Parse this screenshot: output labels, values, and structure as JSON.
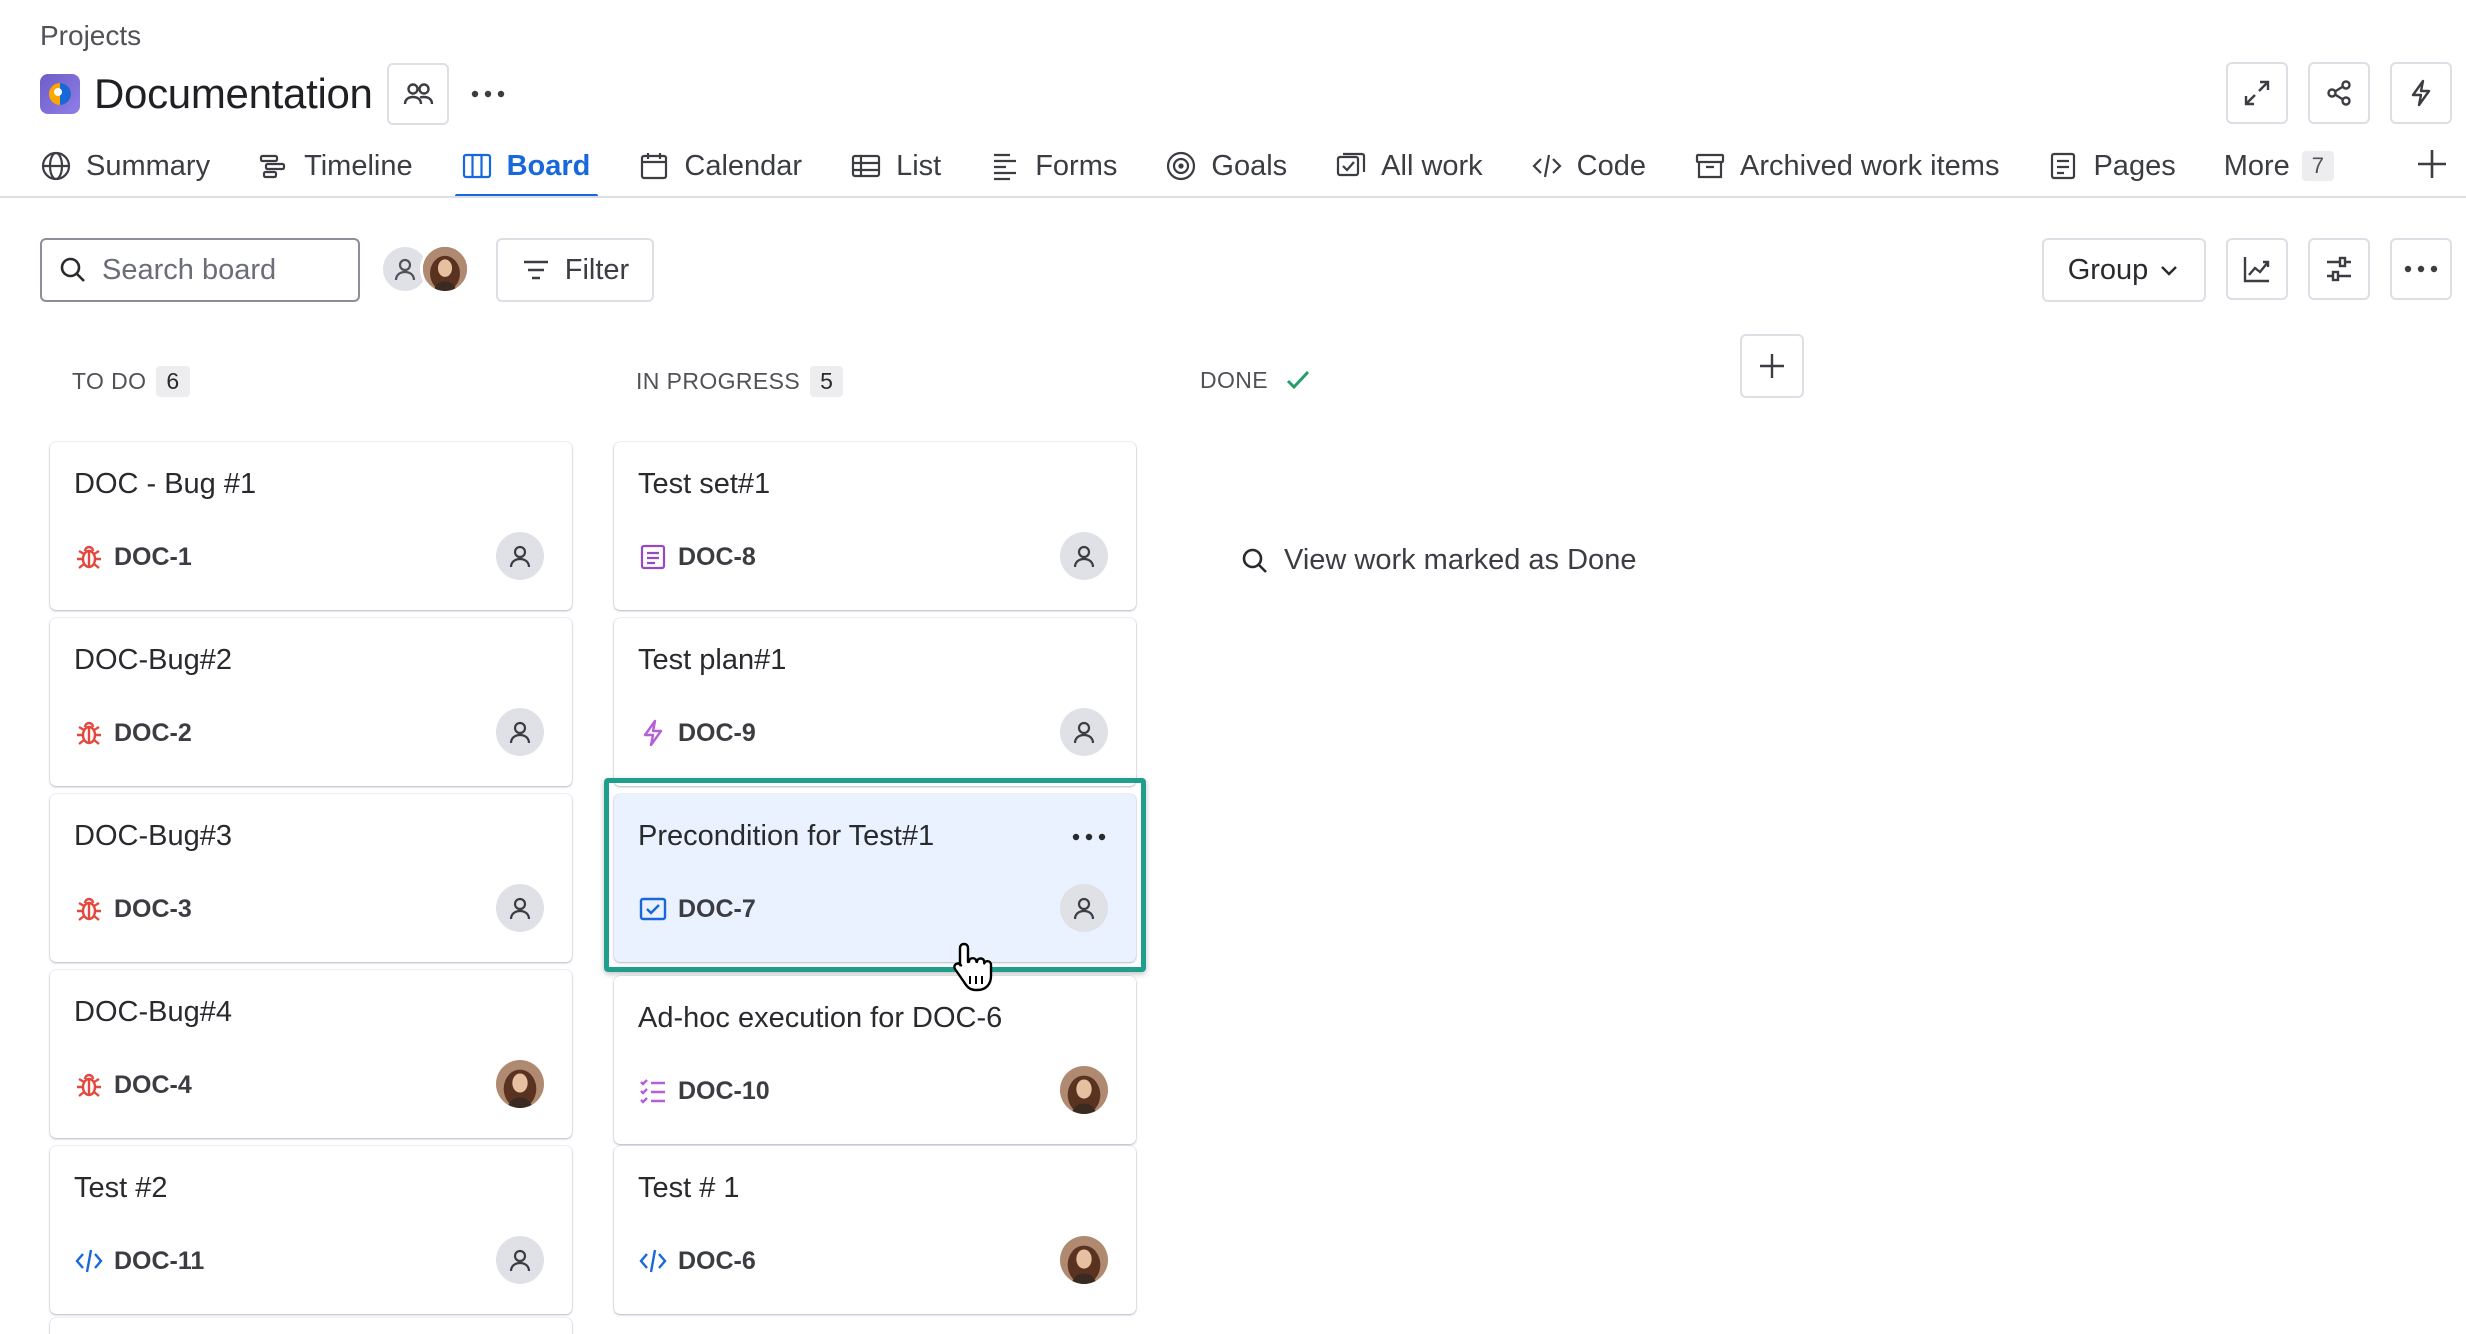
{
  "breadcrumb": "Projects",
  "project": {
    "title": "Documentation"
  },
  "tabs": [
    {
      "label": "Summary",
      "icon": "globe-icon"
    },
    {
      "label": "Timeline",
      "icon": "timeline-icon"
    },
    {
      "label": "Board",
      "icon": "board-icon",
      "active": true
    },
    {
      "label": "Calendar",
      "icon": "calendar-icon"
    },
    {
      "label": "List",
      "icon": "list-icon"
    },
    {
      "label": "Forms",
      "icon": "forms-icon"
    },
    {
      "label": "Goals",
      "icon": "goals-icon"
    },
    {
      "label": "All work",
      "icon": "all-work-icon"
    },
    {
      "label": "Code",
      "icon": "code-icon"
    },
    {
      "label": "Archived work items",
      "icon": "archive-icon"
    },
    {
      "label": "Pages",
      "icon": "pages-icon"
    }
  ],
  "more": {
    "label": "More",
    "count": "7"
  },
  "toolbar": {
    "search_placeholder": "Search board",
    "filter_label": "Filter",
    "group_label": "Group"
  },
  "columns": [
    {
      "name": "TO DO",
      "count": "6"
    },
    {
      "name": "IN PROGRESS",
      "count": "5"
    },
    {
      "name": "DONE"
    }
  ],
  "todo_cards": [
    {
      "title": "DOC - Bug #1",
      "key": "DOC-1",
      "type": "bug-icon",
      "assignee": "unassigned"
    },
    {
      "title": "DOC-Bug#2",
      "key": "DOC-2",
      "type": "bug-icon",
      "assignee": "unassigned"
    },
    {
      "title": "DOC-Bug#3",
      "key": "DOC-3",
      "type": "bug-icon",
      "assignee": "unassigned"
    },
    {
      "title": "DOC-Bug#4",
      "key": "DOC-4",
      "type": "bug-icon",
      "assignee": "user-photo"
    },
    {
      "title": "Test #2",
      "key": "DOC-11",
      "type": "code-test-icon",
      "assignee": "unassigned"
    }
  ],
  "progress_cards": [
    {
      "title": "Test set#1",
      "key": "DOC-8",
      "type": "test-set-icon",
      "assignee": "unassigned"
    },
    {
      "title": "Test plan#1",
      "key": "DOC-9",
      "type": "lightning-icon",
      "assignee": "unassigned"
    },
    {
      "title": "Precondition for Test#1",
      "key": "DOC-7",
      "type": "checkbox-icon",
      "assignee": "unassigned",
      "selected": true
    },
    {
      "title": "Ad-hoc execution for DOC-6",
      "key": "DOC-10",
      "type": "checklist-icon",
      "assignee": "user-photo"
    },
    {
      "title": "Test # 1",
      "key": "DOC-6",
      "type": "code-test-icon",
      "assignee": "user-photo"
    }
  ],
  "done": {
    "link": "View work marked as Done"
  },
  "colors": {
    "accent": "#1868db",
    "bug": "#e2483d",
    "selection": "#1f9e8e",
    "done_check": "#22a06b"
  }
}
